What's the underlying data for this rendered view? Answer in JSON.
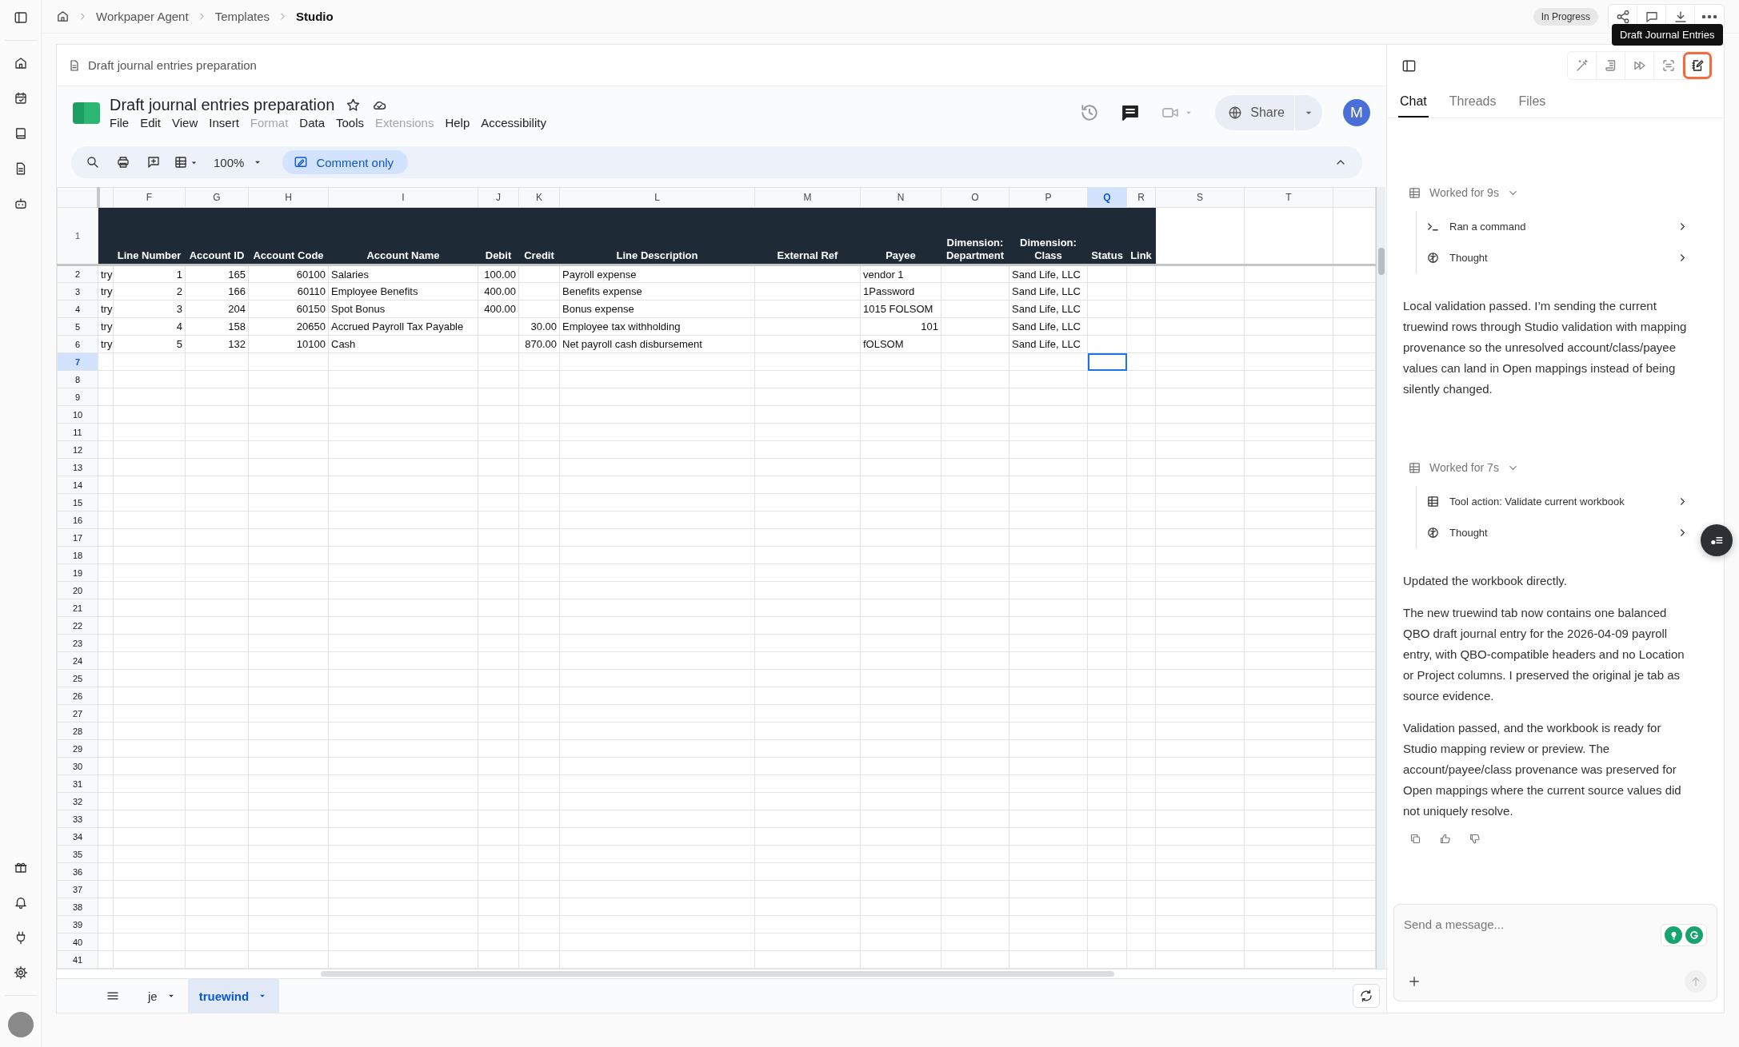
{
  "breadcrumb": [
    {
      "label": "Workpaper Agent",
      "current": false
    },
    {
      "label": "Templates",
      "current": false
    },
    {
      "label": "Studio",
      "current": true
    }
  ],
  "status_badge": "In Progress",
  "tooltip": "Draft Journal Entries",
  "document": {
    "title": "Draft journal entries preparation"
  },
  "spreadsheet": {
    "title": "Draft journal entries preparation",
    "menu": [
      {
        "label": "File",
        "disabled": false
      },
      {
        "label": "Edit",
        "disabled": false
      },
      {
        "label": "View",
        "disabled": false
      },
      {
        "label": "Insert",
        "disabled": false
      },
      {
        "label": "Format",
        "disabled": true
      },
      {
        "label": "Data",
        "disabled": false
      },
      {
        "label": "Tools",
        "disabled": false
      },
      {
        "label": "Extensions",
        "disabled": true
      },
      {
        "label": "Help",
        "disabled": false
      },
      {
        "label": "Accessibility",
        "disabled": false
      }
    ],
    "zoom": "100%",
    "mode_button": "Comment only",
    "share_button": "Share",
    "avatar": "M",
    "columns": [
      {
        "kind": "partial",
        "selected": false
      },
      {
        "kind": "full",
        "label": "F",
        "selected": false
      },
      {
        "kind": "full",
        "label": "G",
        "selected": false
      },
      {
        "kind": "full",
        "label": "H",
        "selected": false
      },
      {
        "kind": "full",
        "label": "I",
        "selected": false
      },
      {
        "kind": "full",
        "label": "J",
        "selected": false
      },
      {
        "kind": "full",
        "label": "K",
        "selected": false
      },
      {
        "kind": "full",
        "label": "L",
        "selected": false
      },
      {
        "kind": "full",
        "label": "M",
        "selected": false
      },
      {
        "kind": "full",
        "label": "N",
        "selected": false
      },
      {
        "kind": "full",
        "label": "O",
        "selected": false
      },
      {
        "kind": "full",
        "label": "P",
        "selected": false
      },
      {
        "kind": "full",
        "label": "Q",
        "selected": true
      },
      {
        "kind": "full",
        "label": "R",
        "selected": false
      },
      {
        "kind": "full",
        "label": "S",
        "selected": false
      },
      {
        "kind": "full",
        "label": "T",
        "selected": false
      },
      {
        "kind": "partial",
        "selected": false
      }
    ],
    "header_row": {
      "number": "1",
      "cells": [
        {},
        {
          "text": "Line Number"
        },
        {
          "text": "Account ID"
        },
        {
          "text": "Account Code"
        },
        {
          "text": "Account Name"
        },
        {
          "text": "Debit"
        },
        {
          "text": "Credit"
        },
        {
          "text": "Line Description"
        },
        {
          "text": "External Ref"
        },
        {
          "text": "Payee"
        },
        {
          "text": "Dimension: Department"
        },
        {
          "text": "Dimension: Class"
        },
        {
          "text": "Status"
        },
        {
          "text": "Link"
        }
      ]
    },
    "rows": [
      {
        "number": "2",
        "selected": false,
        "cells": [
          {
            "text": "try"
          },
          {
            "text": "1"
          },
          {
            "text": "165"
          },
          {
            "text": "60100"
          },
          {
            "text": "Salaries"
          },
          {
            "text": "100.00"
          },
          {},
          {
            "text": "Payroll expense"
          },
          {},
          {
            "text": "vendor 1"
          },
          {},
          {
            "text": "Sand Life, LLC"
          }
        ]
      },
      {
        "number": "3",
        "selected": false,
        "cells": [
          {
            "text": "try"
          },
          {
            "text": "2"
          },
          {
            "text": "166"
          },
          {
            "text": "60110"
          },
          {
            "text": "Employee Benefits"
          },
          {
            "text": "400.00"
          },
          {},
          {
            "text": "Benefits expense"
          },
          {},
          {
            "text": "1Password"
          },
          {},
          {
            "text": "Sand Life, LLC"
          }
        ]
      },
      {
        "number": "4",
        "selected": false,
        "cells": [
          {
            "text": "try"
          },
          {
            "text": "3"
          },
          {
            "text": "204"
          },
          {
            "text": "60150"
          },
          {
            "text": "Spot Bonus"
          },
          {
            "text": "400.00"
          },
          {},
          {
            "text": "Bonus expense"
          },
          {},
          {
            "text": "1015 FOLSOM"
          },
          {},
          {
            "text": "Sand Life, LLC"
          }
        ]
      },
      {
        "number": "5",
        "selected": false,
        "cells": [
          {
            "text": "try"
          },
          {
            "text": "4"
          },
          {
            "text": "158"
          },
          {
            "text": "20650"
          },
          {
            "text": "Accrued Payroll Tax Payable"
          },
          {},
          {
            "text": "30.00"
          },
          {
            "text": "Employee tax withholding"
          },
          {},
          {
            "text": "101"
          },
          {},
          {
            "text": "Sand Life, LLC"
          }
        ]
      },
      {
        "number": "6",
        "selected": false,
        "cells": [
          {
            "text": "try"
          },
          {
            "text": "5"
          },
          {
            "text": "132"
          },
          {
            "text": "10100"
          },
          {
            "text": "Cash"
          },
          {},
          {
            "text": "870.00"
          },
          {
            "text": "Net payroll cash disbursement"
          },
          {},
          {
            "text": "fOLSOM"
          },
          {},
          {
            "text": "Sand Life, LLC"
          }
        ]
      },
      {
        "number": "7",
        "selected": true
      },
      {
        "number": "8",
        "selected": false
      },
      {
        "number": "9",
        "selected": false
      },
      {
        "number": "10",
        "selected": false
      },
      {
        "number": "11",
        "selected": false
      },
      {
        "number": "12",
        "selected": false
      },
      {
        "number": "13",
        "selected": false
      },
      {
        "number": "14",
        "selected": false
      },
      {
        "number": "15",
        "selected": false
      },
      {
        "number": "16",
        "selected": false
      },
      {
        "number": "17",
        "selected": false
      },
      {
        "number": "18",
        "selected": false
      },
      {
        "number": "19",
        "selected": false
      },
      {
        "number": "20",
        "selected": false
      },
      {
        "number": "21",
        "selected": false
      },
      {
        "number": "22",
        "selected": false
      },
      {
        "number": "23",
        "selected": false
      },
      {
        "number": "24",
        "selected": false
      },
      {
        "number": "25",
        "selected": false
      },
      {
        "number": "26",
        "selected": false
      },
      {
        "number": "27",
        "selected": false
      },
      {
        "number": "28",
        "selected": false
      },
      {
        "number": "29",
        "selected": false
      },
      {
        "number": "30",
        "selected": false
      },
      {
        "number": "31",
        "selected": false
      },
      {
        "number": "32",
        "selected": false
      },
      {
        "number": "33",
        "selected": false
      },
      {
        "number": "34",
        "selected": false
      },
      {
        "number": "35",
        "selected": false
      },
      {
        "number": "36",
        "selected": false
      },
      {
        "number": "37",
        "selected": false
      },
      {
        "number": "38",
        "selected": false
      },
      {
        "number": "39",
        "selected": false
      },
      {
        "number": "40",
        "selected": false
      },
      {
        "number": "41",
        "selected": false
      }
    ],
    "sheet_tabs": [
      {
        "label": "je",
        "selected": false
      },
      {
        "label": "truewind",
        "selected": true
      }
    ]
  },
  "panel": {
    "tool_buttons": [
      {
        "selected": false
      },
      {
        "selected": false
      },
      {
        "selected": false
      },
      {
        "selected": false
      },
      {
        "selected": true
      }
    ],
    "tabs": [
      {
        "label": "Chat",
        "selected": true
      },
      {
        "label": "Threads",
        "selected": false
      },
      {
        "label": "Files",
        "selected": false
      }
    ],
    "messages": [
      {
        "kind": "work",
        "summary": "Worked for 9s",
        "expanded": true,
        "steps": [
          {
            "kind": "command",
            "label": "Ran a command"
          },
          {
            "kind": "thought",
            "label": "Thought"
          }
        ]
      },
      {
        "kind": "text",
        "paragraphs": [
          "Local validation passed. I’m sending the current truewind rows through Studio validation with mapping provenance so the unresolved account/class/payee values can land in Open mappings instead of being silently changed."
        ]
      },
      {
        "kind": "work",
        "summary": "Worked for 7s",
        "expanded": true,
        "steps": [
          {
            "kind": "tool",
            "label": "Tool action: Validate current workbook"
          },
          {
            "kind": "thought",
            "label": "Thought"
          }
        ]
      },
      {
        "kind": "text",
        "paragraphs": [
          "Updated the workbook directly.",
          "The new truewind tab now contains one balanced QBO draft journal entry for the 2026-04-09 payroll entry, with QBO-compatible headers and no Location or Project columns. I preserved the original je tab as source evidence.",
          "Validation passed, and the workbook is ready for Studio mapping review or preview. The account/payee/class provenance was preserved for Open mappings where the current source values did not uniquely resolve."
        ]
      },
      {
        "kind": "actions"
      }
    ],
    "composer": {
      "placeholder": "Send a message..."
    }
  }
}
